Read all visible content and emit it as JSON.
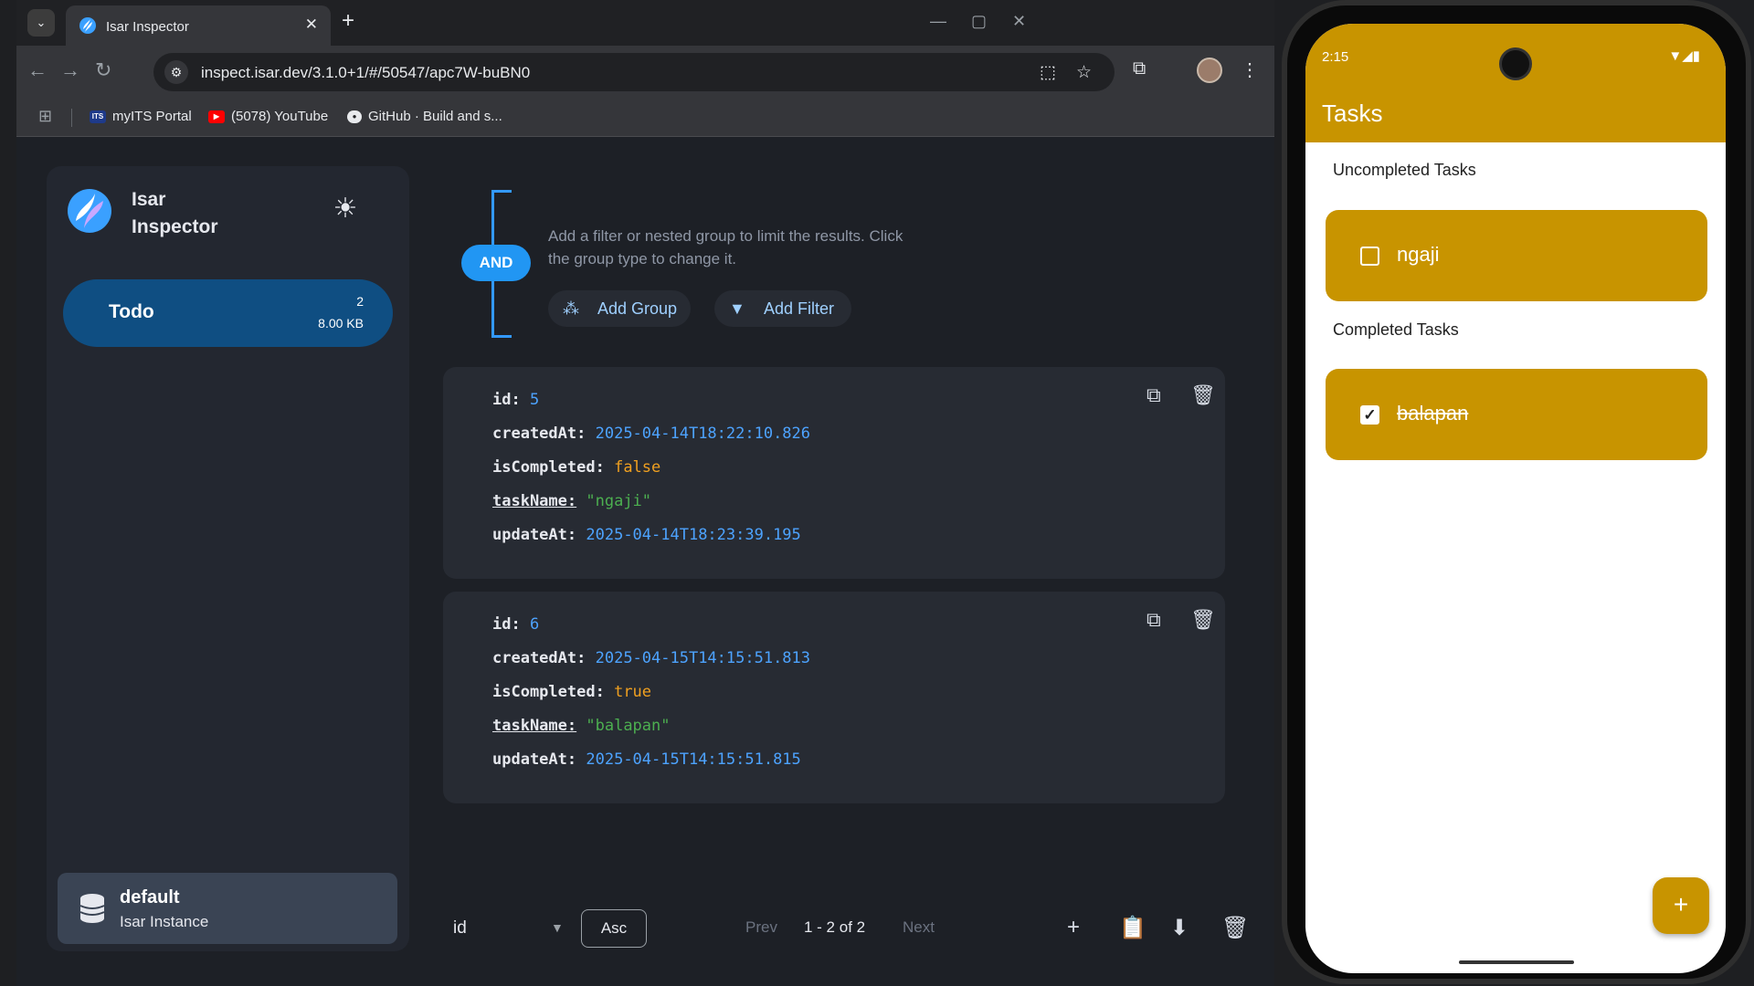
{
  "browser": {
    "tab_title": "Isar Inspector",
    "tab_close_icon": "close-icon",
    "url": "inspect.isar.dev/3.1.0+1/#/50547/apc7W-buBN0",
    "bookmarks": [
      {
        "label": "myITS Portal",
        "icon": "ITS"
      },
      {
        "label": "(5078) YouTube",
        "icon": "youtube-icon"
      },
      {
        "label": "GitHub · Build and s...",
        "icon": "github-icon"
      }
    ]
  },
  "inspector": {
    "app_name": "Isar Inspector",
    "collection": {
      "name": "Todo",
      "count": "2",
      "size": "8.00 KB"
    },
    "instance": {
      "name": "default",
      "subtitle": "Isar Instance"
    },
    "filter": {
      "group_type": "AND",
      "hint": "Add a filter or nested group to limit the results. Click the group type to change it.",
      "add_group": "Add Group",
      "add_filter": "Add Filter"
    },
    "records": [
      {
        "id_key": "id:",
        "id": "5",
        "createdAt_key": "createdAt:",
        "createdAt": "2025-04-14T18:22:10.826",
        "isCompleted_key": "isCompleted:",
        "isCompleted": "false",
        "taskName_key": "taskName:",
        "taskName": "\"ngaji\"",
        "updateAt_key": "updateAt:",
        "updateAt": "2025-04-14T18:23:39.195"
      },
      {
        "id_key": "id:",
        "id": "6",
        "createdAt_key": "createdAt:",
        "createdAt": "2025-04-15T14:15:51.813",
        "isCompleted_key": "isCompleted:",
        "isCompleted": "true",
        "taskName_key": "taskName:",
        "taskName": "\"balapan\"",
        "updateAt_key": "updateAt:",
        "updateAt": "2025-04-15T14:15:51.815"
      }
    ],
    "sort_field": "id",
    "sort_order": "Asc",
    "pagination": {
      "prev": "Prev",
      "info": "1 - 2 of 2",
      "next": "Next"
    }
  },
  "phone": {
    "time": "2:15",
    "app_title": "Tasks",
    "uncompleted_title": "Uncompleted Tasks",
    "completed_title": "Completed Tasks",
    "uncompleted": [
      {
        "name": "ngaji"
      }
    ],
    "completed": [
      {
        "name": "balapan"
      }
    ],
    "fab": "+"
  },
  "colors": {
    "accent": "#2196f3",
    "collection_bg": "#0f4e82",
    "phone_primary": "#c89400",
    "value_number": "#4da3ff",
    "value_bool": "#f0a020",
    "value_string": "#4caf50"
  }
}
